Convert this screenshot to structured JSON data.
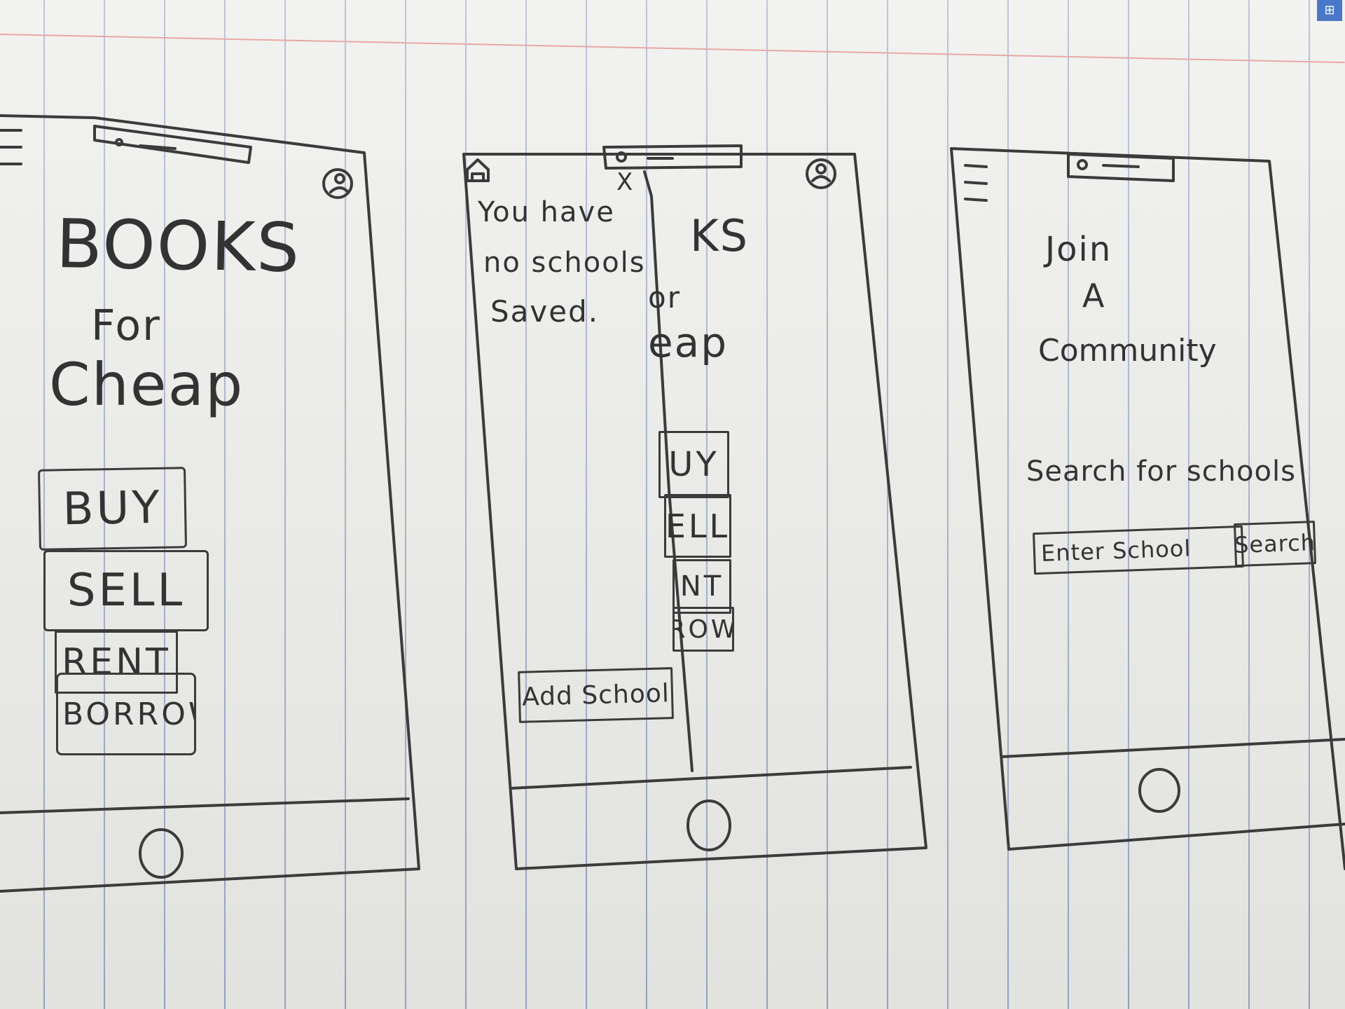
{
  "screen1": {
    "title_line1": "BOOKS",
    "title_line2": "For",
    "title_line3": "Cheap",
    "buttons": [
      "BUY",
      "SELL",
      "RENT",
      "BORROW"
    ]
  },
  "screen2": {
    "empty_line1": "You have",
    "empty_line2": "no schools",
    "empty_line3": "Saved.",
    "add_school": "Add School",
    "close_glyph": "X",
    "bg_title_line1": "KS",
    "bg_title_line2": "or",
    "bg_title_line3": "eap",
    "bg_buttons": [
      "UY",
      "ELL",
      "NT",
      "ROW"
    ]
  },
  "screen3": {
    "heading_line1": "Join",
    "heading_line2": "A",
    "heading_line3": "Community",
    "search_label": "Search for schools",
    "search_placeholder": "Enter School",
    "search_button": "Search"
  },
  "icons": [
    "hamburger-menu-icon",
    "profile-icon",
    "home-button-icon",
    "camera-notch-icon",
    "close-icon",
    "home-icon"
  ]
}
